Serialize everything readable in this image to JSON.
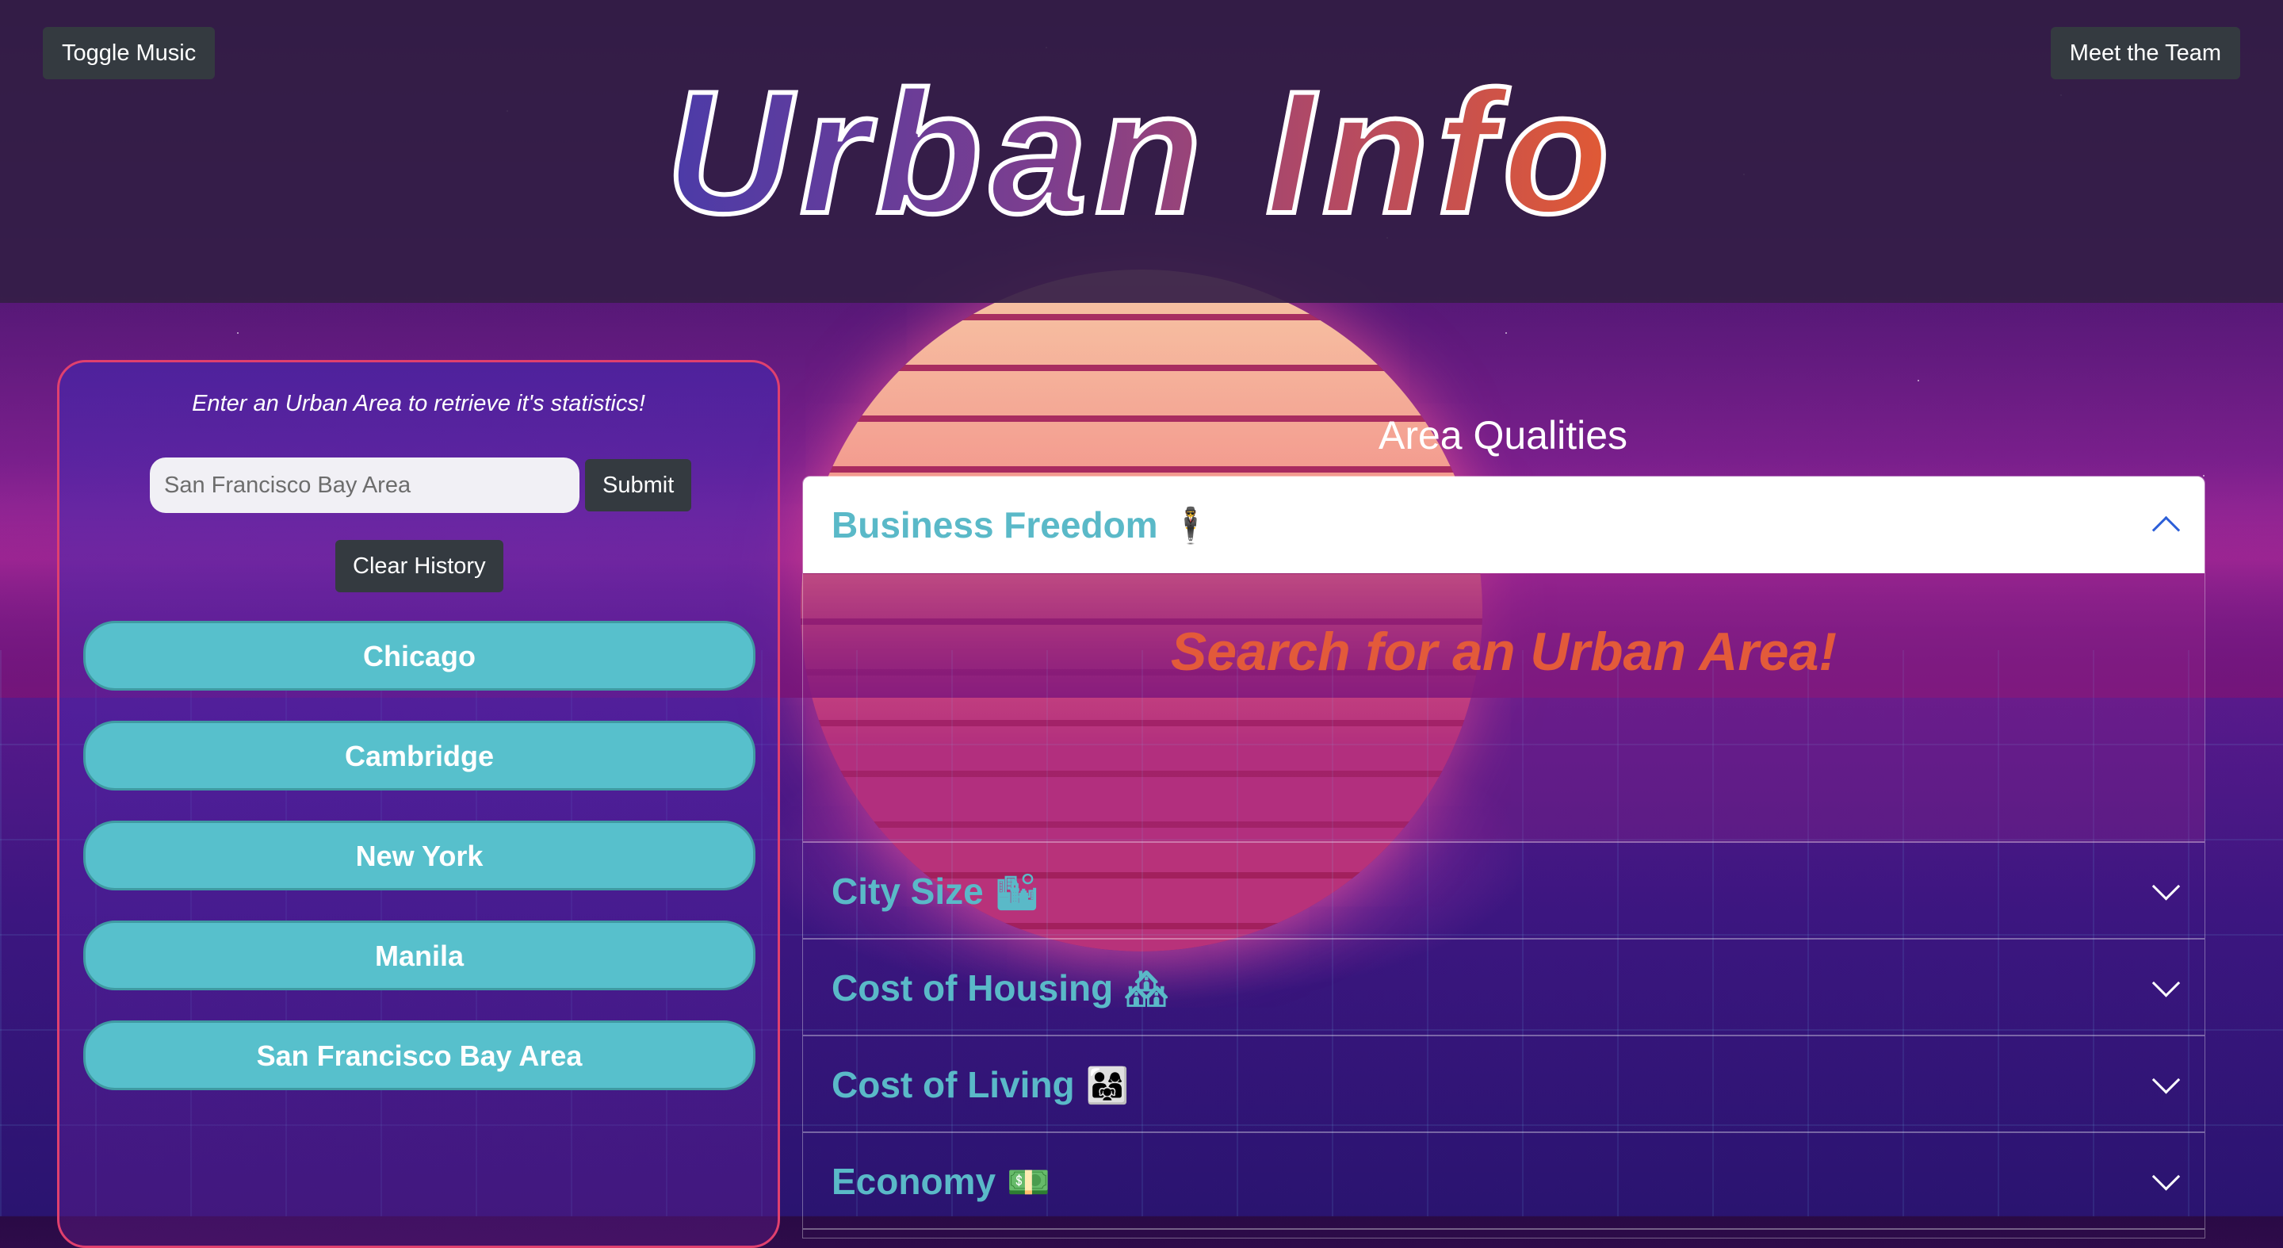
{
  "header": {
    "toggle_music": "Toggle Music",
    "meet_team": "Meet the Team",
    "title": "Urban Info"
  },
  "search": {
    "prompt": "Enter an Urban Area to retrieve it's statistics!",
    "placeholder": "San Francisco Bay Area",
    "submit_label": "Submit",
    "clear_label": "Clear History",
    "history": [
      "Chicago",
      "Cambridge",
      "New York",
      "Manila",
      "San Francisco Bay Area"
    ]
  },
  "qualities": {
    "heading": "Area Qualities",
    "placeholder_message": "Search for an Urban Area!",
    "items": [
      {
        "label": "Business Freedom",
        "icon": "🕴"
      },
      {
        "label": "City Size",
        "icon": "🏙"
      },
      {
        "label": "Cost of Housing",
        "icon": "🏘"
      },
      {
        "label": "Cost of Living",
        "icon": "👨‍👩‍👧"
      },
      {
        "label": "Economy",
        "icon": "💵"
      }
    ]
  },
  "colors": {
    "accent_teal": "#57c0cc",
    "title_gradient_start": "#4b3ba8",
    "title_gradient_end": "#e25a33",
    "placeholder_orange": "#e35a3a"
  }
}
